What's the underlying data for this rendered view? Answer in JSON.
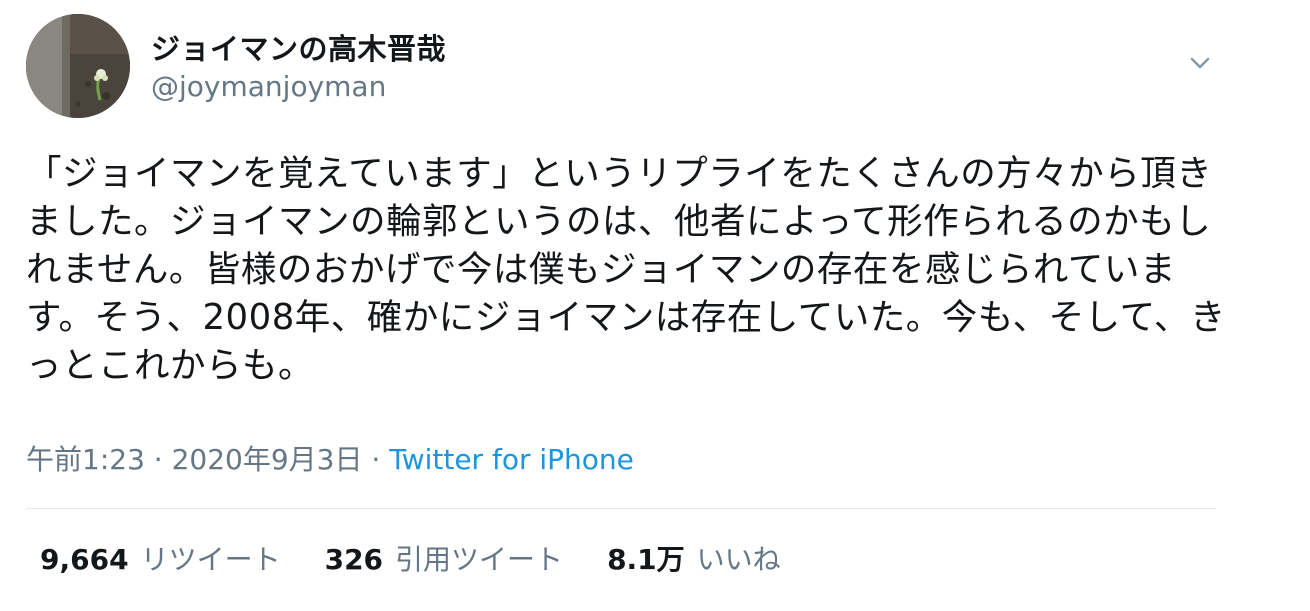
{
  "user": {
    "display_name": "ジョイマンの高木晋哉",
    "handle": "@joymanjoyman"
  },
  "tweet": {
    "text": "「ジョイマンを覚えています」というリプライをたくさんの方々から頂きました。ジョイマンの輪郭というのは、他者によって形作られるのかもしれません。皆様のおかげで今は僕もジョイマンの存在を感じられています。そう、2008年、確かにジョイマンは存在していた。今も、そして、きっとこれからも。",
    "time": "午前1:23",
    "date": "2020年9月3日",
    "separator": "·",
    "source": "Twitter for iPhone"
  },
  "stats": {
    "retweets_count": "9,664",
    "retweets_label": "リツイート",
    "quotes_count": "326",
    "quotes_label": "引用ツイート",
    "likes_count": "8.1万",
    "likes_label": "いいね"
  },
  "icons": {
    "menu": "chevron-down-icon"
  },
  "colors": {
    "text": "#14171a",
    "secondary": "#657786",
    "link": "#1b95e0",
    "divider": "#e1e8ed"
  }
}
